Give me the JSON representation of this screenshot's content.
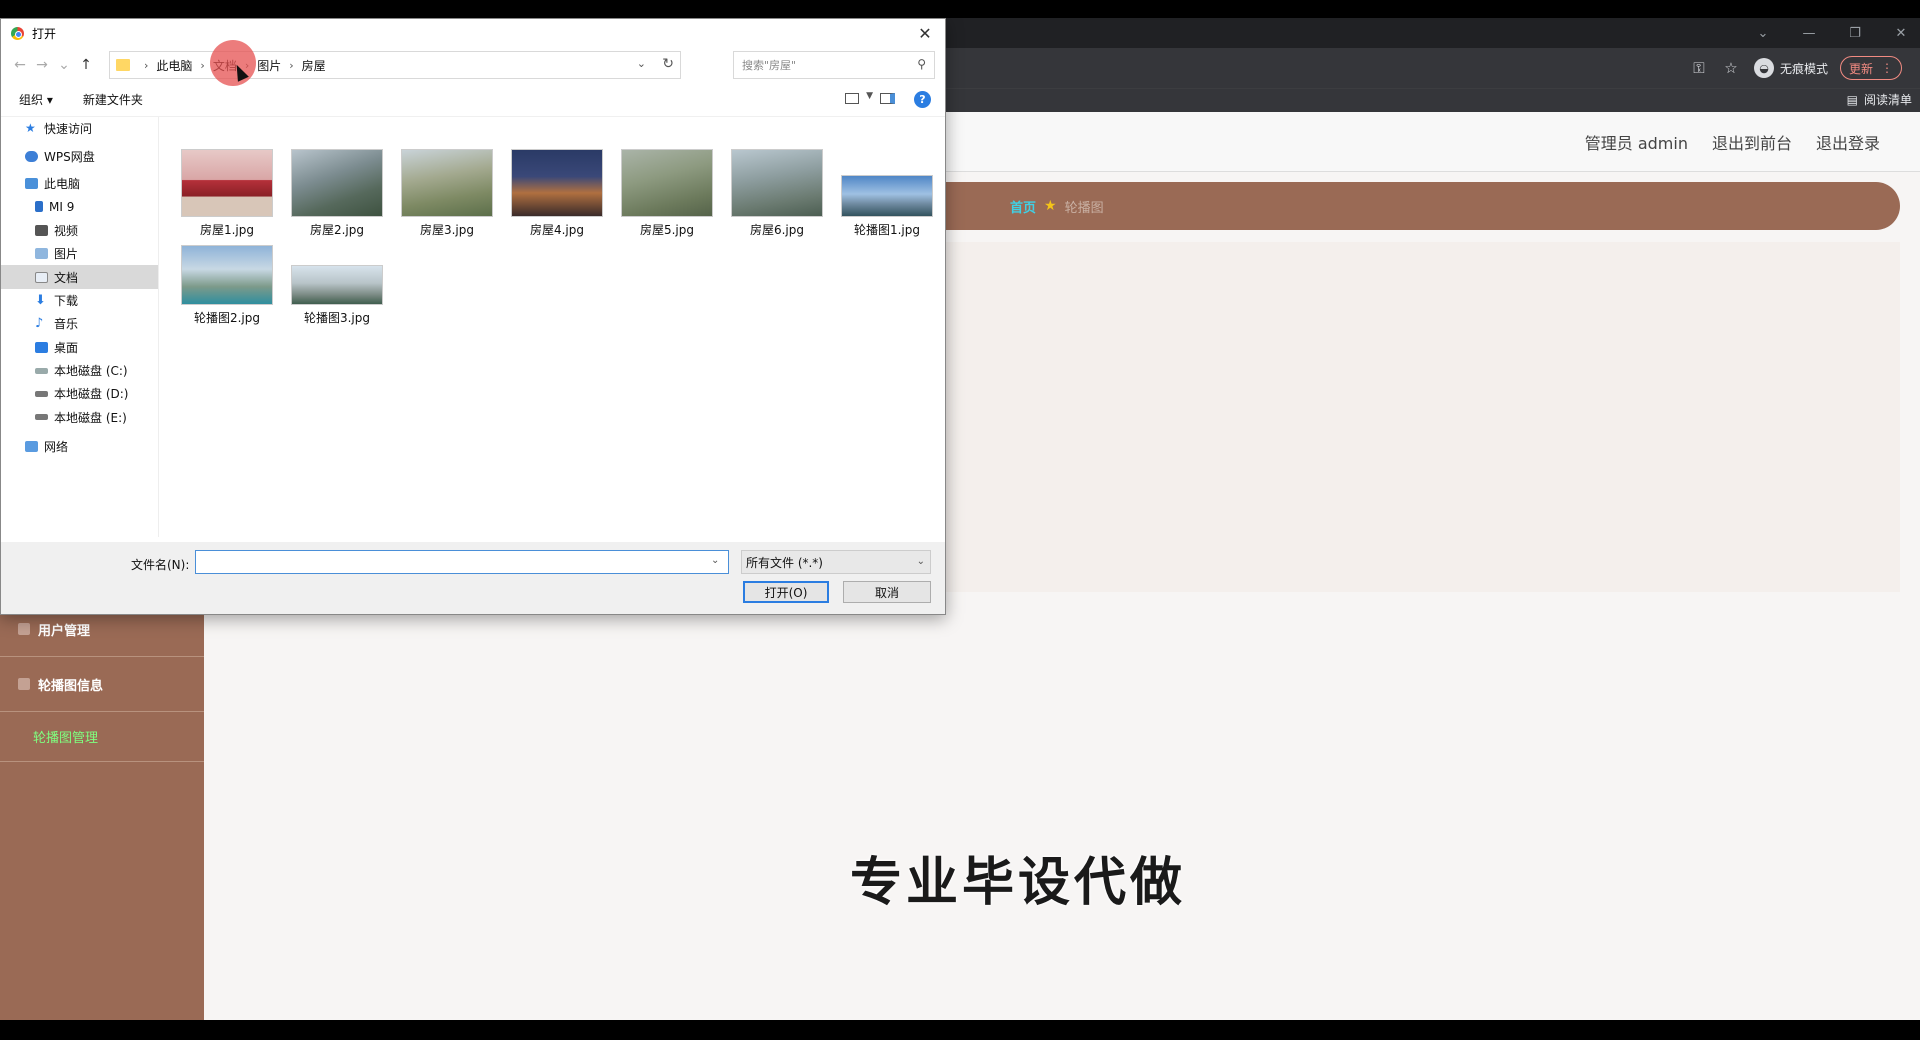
{
  "browser": {
    "incognito_label": "无痕模式",
    "update_label": "更新",
    "reading_list": "阅读清单"
  },
  "page": {
    "header": {
      "admin_label": "管理员 admin",
      "front_link": "退出到前台",
      "logout_link": "退出登录"
    },
    "breadcrumb": {
      "home": "首页",
      "current": "轮播图"
    },
    "sidebar": {
      "items": [
        {
          "label": "用户管理"
        },
        {
          "label": "轮播图信息"
        }
      ],
      "sub_item": "轮播图管理"
    },
    "watermark": "专业毕设代做"
  },
  "dialog": {
    "title": "打开",
    "path": [
      "此电脑",
      "文档",
      "图片",
      "房屋"
    ],
    "search_placeholder": "搜索\"房屋\"",
    "toolbar": {
      "organize": "组织 ▾",
      "new_folder": "新建文件夹"
    },
    "nav_tree": [
      {
        "label": "快速访问"
      },
      {
        "label": "WPS网盘"
      },
      {
        "label": "此电脑"
      },
      {
        "label": "MI 9"
      },
      {
        "label": "视频"
      },
      {
        "label": "图片"
      },
      {
        "label": "文档"
      },
      {
        "label": "下载"
      },
      {
        "label": "音乐"
      },
      {
        "label": "桌面"
      },
      {
        "label": "本地磁盘 (C:)"
      },
      {
        "label": "本地磁盘 (D:)"
      },
      {
        "label": "本地磁盘 (E:)"
      },
      {
        "label": "网络"
      }
    ],
    "files": [
      {
        "name": "房屋1.jpg"
      },
      {
        "name": "房屋2.jpg"
      },
      {
        "name": "房屋3.jpg"
      },
      {
        "name": "房屋4.jpg"
      },
      {
        "name": "房屋5.jpg"
      },
      {
        "name": "房屋6.jpg"
      },
      {
        "name": "轮播图1.jpg"
      },
      {
        "name": "轮播图2.jpg"
      },
      {
        "name": "轮播图3.jpg"
      }
    ],
    "filename_label": "文件名(N):",
    "filename_value": "",
    "filetype": "所有文件 (*.*)",
    "open_button": "打开(O)",
    "cancel_button": "取消"
  }
}
